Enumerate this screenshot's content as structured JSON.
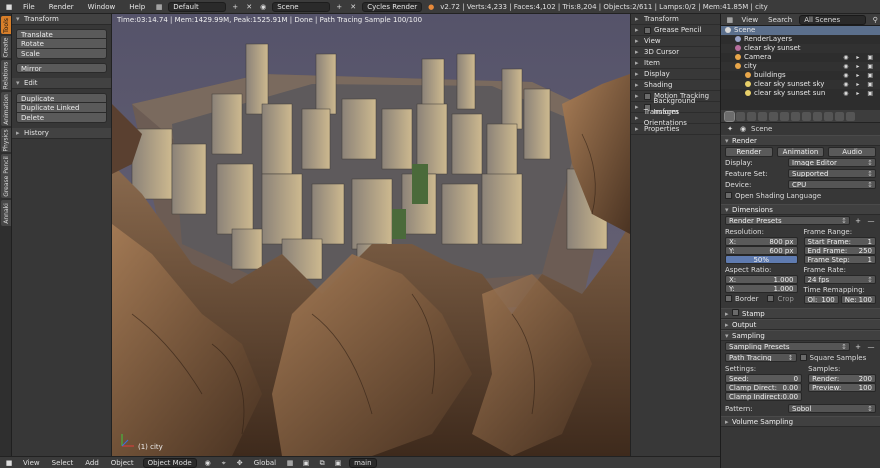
{
  "topbar": {
    "menus": [
      "File",
      "Render",
      "Window",
      "Help"
    ],
    "screen_layout": "Default",
    "scene": "Scene",
    "engine": "Cycles Render",
    "stats": "v2.72 | Verts:4,233 | Faces:4,102 | Tris:8,204 | Objects:2/611 | Lamps:0/2 | Mem:41.85M | city"
  },
  "left_tabs": [
    "Tools",
    "Create",
    "Relations",
    "Animation",
    "Physics",
    "Grease Pencil",
    "Annaki"
  ],
  "toolshelf": {
    "transform": {
      "title": "Transform",
      "items": [
        "Translate",
        "Rotate",
        "Scale"
      ],
      "mirror": "Mirror"
    },
    "edit": {
      "title": "Edit",
      "items": [
        "Duplicate",
        "Duplicate Linked",
        "Delete"
      ]
    },
    "history": {
      "title": "History"
    }
  },
  "viewport": {
    "info": "Time:03:14.74 | Mem:1429.99M, Peak:1525.91M | Done | Path Tracing Sample 100/100",
    "object_label": "(1) city"
  },
  "npanel": [
    "Transform",
    "Grease Pencil",
    "View",
    "3D Cursor",
    "Item",
    "Display",
    "Shading",
    "Motion Tracking",
    "Background Images",
    "Transform Orientations",
    "Properties"
  ],
  "bottombar": {
    "menus": [
      "View",
      "Select",
      "Add",
      "Object"
    ],
    "mode": "Object Mode",
    "pivot": "Global",
    "layer": "main"
  },
  "outliner": {
    "menus": [
      "View",
      "Search"
    ],
    "filter": "All Scenes",
    "rows": [
      {
        "label": "Scene",
        "color": "#d8d8d8",
        "indent": 0,
        "sel": true
      },
      {
        "label": "RenderLayers",
        "color": "#9aa4c8",
        "indent": 1,
        "sel": false
      },
      {
        "label": "clear sky sunset",
        "color": "#b86f9e",
        "indent": 1,
        "sel": false
      },
      {
        "label": "Camera",
        "color": "#e8a64a",
        "indent": 1,
        "sel": false
      },
      {
        "label": "city",
        "color": "#e8a64a",
        "indent": 1,
        "sel": false
      },
      {
        "label": "buildings",
        "color": "#e8a64a",
        "indent": 2,
        "sel": false
      },
      {
        "label": "clear sky sunset sky",
        "color": "#e8d06a",
        "indent": 2,
        "sel": false
      },
      {
        "label": "clear sky sunset sun",
        "color": "#e8d06a",
        "indent": 2,
        "sel": false
      }
    ]
  },
  "props": {
    "breadcrumb": "Scene",
    "render": {
      "title": "Render",
      "render_btn": "Render",
      "animation_btn": "Animation",
      "audio_btn": "Audio",
      "display_label": "Display:",
      "display_value": "Image Editor",
      "featureset_label": "Feature Set:",
      "featureset_value": "Supported",
      "device_label": "Device:",
      "device_value": "CPU",
      "osl_label": "Open Shading Language"
    },
    "dimensions": {
      "title": "Dimensions",
      "presets": "Render Presets",
      "resolution": "Resolution:",
      "x_label": "X:",
      "x": "800 px",
      "y_label": "Y:",
      "y": "600 px",
      "pct": "50%",
      "frame_range": "Frame Range:",
      "start_label": "Start Frame:",
      "start": "1",
      "end_label": "End Frame:",
      "end": "250",
      "step_label": "Frame Step:",
      "step": "1",
      "aspect": "Aspect Ratio:",
      "ax_label": "X:",
      "ax": "1.000",
      "ay_label": "Y:",
      "ay": "1.000",
      "frame_rate": "Frame Rate:",
      "fps": "24 fps",
      "border": "Border",
      "crop": "Crop",
      "time_remap": "Time Remapping:",
      "old_label": "Ol:",
      "old": "100",
      "new_label": "Ne:",
      "new": "100"
    },
    "stamp": "Stamp",
    "output": "Output",
    "sampling": {
      "title": "Sampling",
      "presets": "Sampling Presets",
      "method": "Path Tracing",
      "square": "Square Samples",
      "settings": "Settings:",
      "samples": "Samples:",
      "seed_label": "Seed:",
      "seed": "0",
      "render_label": "Render:",
      "render": "200",
      "cd_label": "Clamp Direct:",
      "cd": "0.00",
      "preview_label": "Preview:",
      "preview": "100",
      "ci_label": "Clamp Indirect:",
      "ci": "0.00",
      "pattern_label": "Pattern:",
      "pattern": "Sobol"
    },
    "volume": "Volume Sampling"
  }
}
